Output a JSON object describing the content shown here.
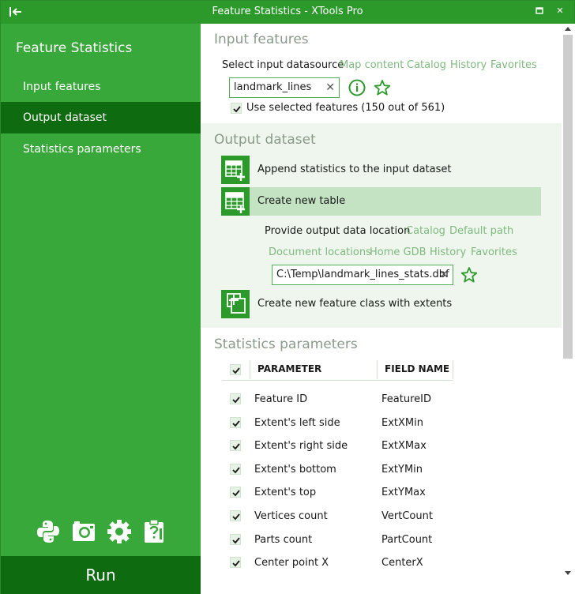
{
  "window": {
    "title": "Feature Statistics - XTools Pro",
    "restore_glyph": "▫",
    "close_glyph": "✕"
  },
  "sidebar": {
    "heading": "Feature Statistics",
    "items": [
      {
        "label": "Input features",
        "active": false
      },
      {
        "label": "Output dataset",
        "active": true
      },
      {
        "label": "Statistics parameters",
        "active": false
      }
    ],
    "tools": [
      "python-icon",
      "camera-icon",
      "gear-icon",
      "clipboard-help-icon"
    ],
    "run_label": "Run"
  },
  "input_features": {
    "title": "Input features",
    "datasource_label": "Select input datasource",
    "datasource_links": [
      "Map content",
      "Catalog",
      "History",
      "Favorites"
    ],
    "input_value": "landmark_lines",
    "clear_glyph": "✕",
    "use_selected_label": "Use selected features (150 out of 561)",
    "use_selected_checked": true
  },
  "output_dataset": {
    "title": "Output dataset",
    "options": [
      {
        "label": "Append statistics to the input dataset",
        "icon": "append-table-icon",
        "selected": false
      },
      {
        "label": "Create new table",
        "icon": "new-table-icon",
        "selected": true
      },
      {
        "label": "Create new feature class with extents",
        "icon": "new-feature-class-icon",
        "selected": false
      }
    ],
    "location_label": "Provide output data location",
    "location_links_row1": [
      "Catalog",
      "Default path"
    ],
    "location_links_row2": [
      "Document locations",
      "Home GDB",
      "History",
      "Favorites"
    ],
    "output_path": "C:\\Temp\\landmark_lines_stats.dbf"
  },
  "statistics": {
    "title": "Statistics parameters",
    "columns": [
      "PARAMETER",
      "FIELD NAME"
    ],
    "rows": [
      {
        "parameter": "Feature ID",
        "field": "FeatureID",
        "checked": true
      },
      {
        "parameter": "Extent's left side",
        "field": "ExtXMin",
        "checked": true
      },
      {
        "parameter": "Extent's right side",
        "field": "ExtXMax",
        "checked": true
      },
      {
        "parameter": "Extent's bottom",
        "field": "ExtYMin",
        "checked": true
      },
      {
        "parameter": "Extent's top",
        "field": "ExtYMax",
        "checked": true
      },
      {
        "parameter": "Vertices count",
        "field": "VertCount",
        "checked": true
      },
      {
        "parameter": "Parts count",
        "field": "PartCount",
        "checked": true
      },
      {
        "parameter": "Center point X",
        "field": "CenterX",
        "checked": true
      }
    ]
  },
  "colors": {
    "title_bar": "#2b9a2b",
    "sidebar": "#39a83a",
    "sidebar_active": "#0f6b10",
    "accent": "#2b9a2b",
    "link": "#7fb97f",
    "section_title": "#8a9a8a"
  }
}
